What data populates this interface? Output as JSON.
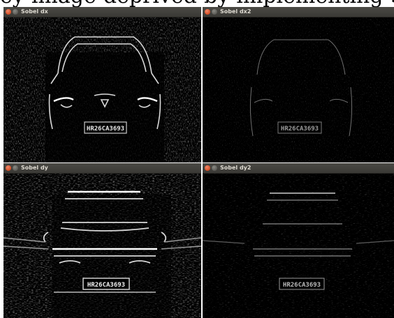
{
  "header_text": "ey-image-deprived-by-implementing-Sobel-Edge",
  "windows": [
    {
      "title": "Sobel dx",
      "plate": "HR26CA3693"
    },
    {
      "title": "Sobel dx2",
      "plate": "HR26CA3693"
    },
    {
      "title": "Sobel dy",
      "plate": "HR26CA3693"
    },
    {
      "title": "Sobel dy2",
      "plate": "HR26CA3693"
    }
  ],
  "colors": {
    "titlebar": "#3e3d39",
    "close_button": "#e05f35",
    "background": "#000000"
  },
  "icons": [
    "close-icon",
    "minimize-icon"
  ]
}
